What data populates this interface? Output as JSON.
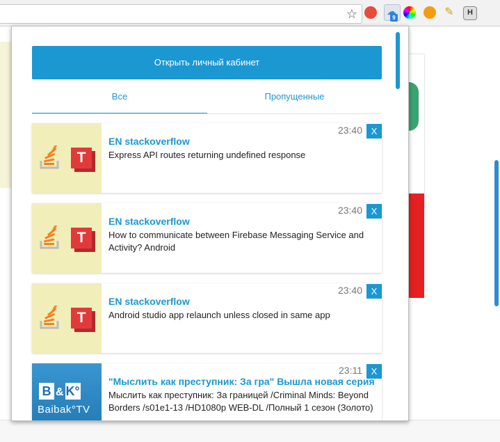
{
  "browser": {
    "badge_count": "9",
    "bookmark_star": "☆",
    "extensions": [
      "stop-icon",
      "cloud-icon",
      "color-wheel-icon",
      "lifebuoy-icon",
      "broom-icon",
      "h-icon"
    ],
    "extension_h_label": "H"
  },
  "popup": {
    "open_cabinet_label": "Открыть личный кабинет",
    "tabs": [
      {
        "label": "Все",
        "active": true
      },
      {
        "label": "Пропущенные",
        "active": false
      }
    ],
    "close_label": "X",
    "notifications": [
      {
        "time": "23:40",
        "title": "EN stackoverflow",
        "body": "Express API routes returning undefined response",
        "thumb": "stackoverflow"
      },
      {
        "time": "23:40",
        "title": "EN stackoverflow",
        "body": "How to communicate between Firebase Messaging Service and Activity? Android",
        "thumb": "stackoverflow"
      },
      {
        "time": "23:40",
        "title": "EN stackoverflow",
        "body": "Android studio app relaunch unless closed in same app",
        "thumb": "stackoverflow"
      },
      {
        "time": "23:11",
        "title": "\"Мыслить как преступник: За гра\" Вышла новая серия",
        "body": "Мыслить как преступник: За границей /Criminal Minds: Beyond Borders /s01e1-13 /HD1080p WEB-DL /Полный 1 сезон (Золото)",
        "thumb": "baibak"
      }
    ],
    "t_logo_letter": "T",
    "baibak_tile_b": "B",
    "baibak_amp": "&",
    "baibak_tile_k": "K°",
    "baibak_tv": "Baibak°TV"
  },
  "colors": {
    "accent": "#1b97d2",
    "thumb_bg": "#f2eeb9",
    "t_red": "#e23a3a"
  }
}
